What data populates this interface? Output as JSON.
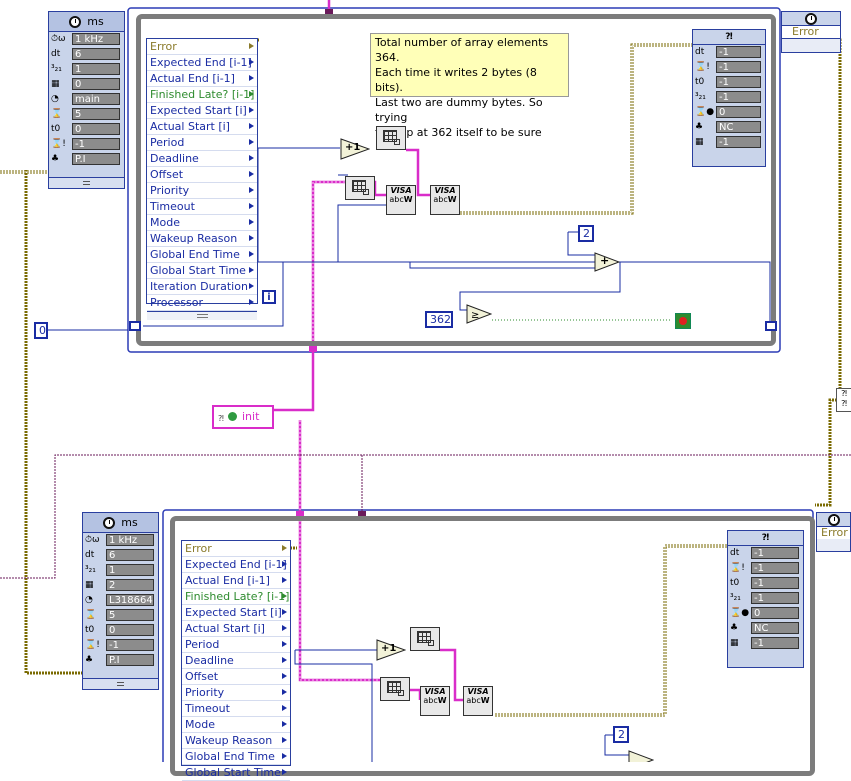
{
  "timed_loop_top": {
    "config": {
      "unit": "ms",
      "rows": [
        {
          "icon": "clock-source-icon",
          "value": "1 kHz"
        },
        {
          "icon": "dt-label",
          "label": "dt",
          "value": "6"
        },
        {
          "icon": "offset-icon",
          "value": "1"
        },
        {
          "icon": "processor-icon",
          "value": "0"
        },
        {
          "icon": "structure-name-icon",
          "value": "main"
        },
        {
          "icon": "priority-icon",
          "value": "5"
        },
        {
          "icon": "t0-label",
          "label": "t0",
          "value": "0"
        },
        {
          "icon": "timeout-icon",
          "value": "-1"
        },
        {
          "icon": "mode-icon",
          "value": "P.I"
        }
      ]
    },
    "left_data": [
      "Error",
      "Expected End [i-1]",
      "Actual End [i-1]",
      "Finished Late? [i-1]",
      "Expected Start [i]",
      "Actual Start [i]",
      "Period",
      "Deadline",
      "Offset",
      "Priority",
      "Timeout",
      "Mode",
      "Wakeup Reason",
      "Global End Time",
      "Global Start Time",
      "Iteration Duration",
      "Processor"
    ],
    "right_data": [
      {
        "label": "dt",
        "value": "-1"
      },
      {
        "label": "",
        "value": "-1"
      },
      {
        "label": "t0",
        "value": "-1"
      },
      {
        "label": "",
        "value": "-1"
      },
      {
        "label": "",
        "value": "0"
      },
      {
        "label": "",
        "value": "NC"
      },
      {
        "label": "",
        "value": "-1"
      }
    ],
    "comment": [
      "Total number of array elements 364.",
      "Each time it writes 2 bytes (8 bits).",
      "Last two are dummy bytes. So trying",
      "to stop at 362 itself to be sure"
    ],
    "constants": {
      "count": "2",
      "stop_at": "362",
      "init_index": "0"
    },
    "index_label": "i",
    "increment_label": "+1",
    "add_label": "+",
    "error_out_label": "Error"
  },
  "timed_loop_bottom": {
    "config": {
      "unit": "ms",
      "rows": [
        {
          "icon": "clock-source-icon",
          "value": "1 kHz"
        },
        {
          "icon": "dt-label",
          "label": "dt",
          "value": "6"
        },
        {
          "icon": "offset-icon",
          "value": "1"
        },
        {
          "icon": "processor-icon",
          "value": "2"
        },
        {
          "icon": "structure-name-icon",
          "value": "L318664"
        },
        {
          "icon": "priority-icon",
          "value": "5"
        },
        {
          "icon": "t0-label",
          "label": "t0",
          "value": "0"
        },
        {
          "icon": "timeout-icon",
          "value": "-1"
        },
        {
          "icon": "mode-icon",
          "value": "P.I"
        }
      ]
    },
    "left_data": [
      "Error",
      "Expected End [i-1]",
      "Actual End [i-1]",
      "Finished Late? [i-1]",
      "Expected Start [i]",
      "Actual Start [i]",
      "Period",
      "Deadline",
      "Offset",
      "Priority",
      "Timeout",
      "Mode",
      "Wakeup Reason",
      "Global End Time",
      "Global Start Time"
    ],
    "right_data": [
      {
        "label": "dt",
        "value": "-1"
      },
      {
        "label": "",
        "value": "-1"
      },
      {
        "label": "t0",
        "value": "-1"
      },
      {
        "label": "",
        "value": "-1"
      },
      {
        "label": "",
        "value": "0"
      },
      {
        "label": "",
        "value": "NC"
      },
      {
        "label": "",
        "value": "-1"
      }
    ],
    "constants": {
      "count": "2"
    },
    "increment_label": "+1",
    "error_out_label": "Error"
  },
  "visa_write": {
    "line1": "VISA",
    "line2": "abc",
    "line3": "W"
  },
  "enum_constant": {
    "label": "init"
  },
  "colors": {
    "error_wire": "#7a6a00",
    "visa_wire": "#d92dc9",
    "numeric_wire": "#1a2ca3",
    "loop_border": "#7c7c7c"
  }
}
